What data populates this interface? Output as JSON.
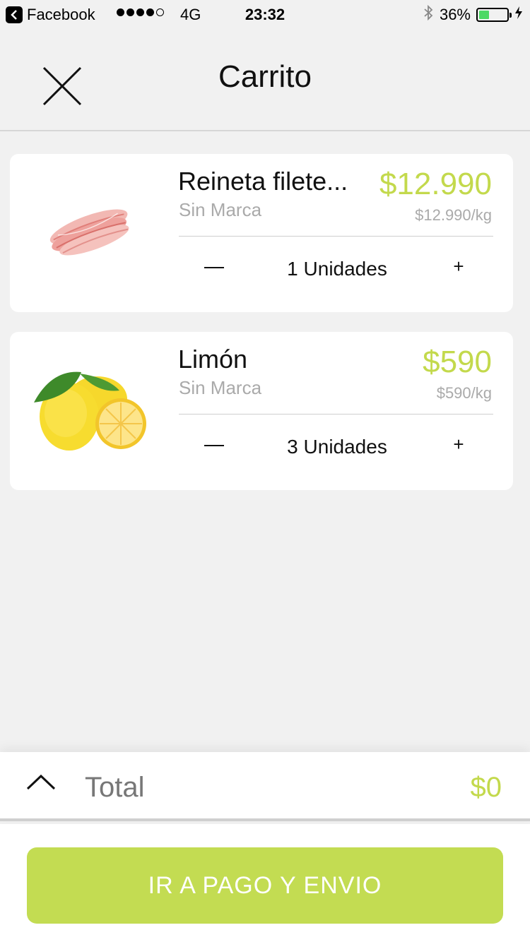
{
  "status_bar": {
    "back_app": "Facebook",
    "network": "4G",
    "time": "23:32",
    "battery": "36%",
    "battery_level": 0.36,
    "signal_bars_filled": 4,
    "signal_bars_total": 5
  },
  "header": {
    "title": "Carrito",
    "close_icon": "close-icon"
  },
  "cart": {
    "items": [
      {
        "name": "Reineta filete...",
        "brand": "Sin Marca",
        "price": "$12.990",
        "unit_price": "$12.990/kg",
        "quantity_label": "1 Unidades",
        "image": "fish-fillet-image"
      },
      {
        "name": "Limón",
        "brand": "Sin Marca",
        "price": "$590",
        "unit_price": "$590/kg",
        "quantity_label": "3 Unidades",
        "image": "lemon-image"
      }
    ]
  },
  "total": {
    "label": "Total",
    "value": "$0"
  },
  "checkout": {
    "label": "IR A PAGO Y ENVIO"
  },
  "colors": {
    "accent": "#c3d94c",
    "background": "#f1f1f1"
  }
}
